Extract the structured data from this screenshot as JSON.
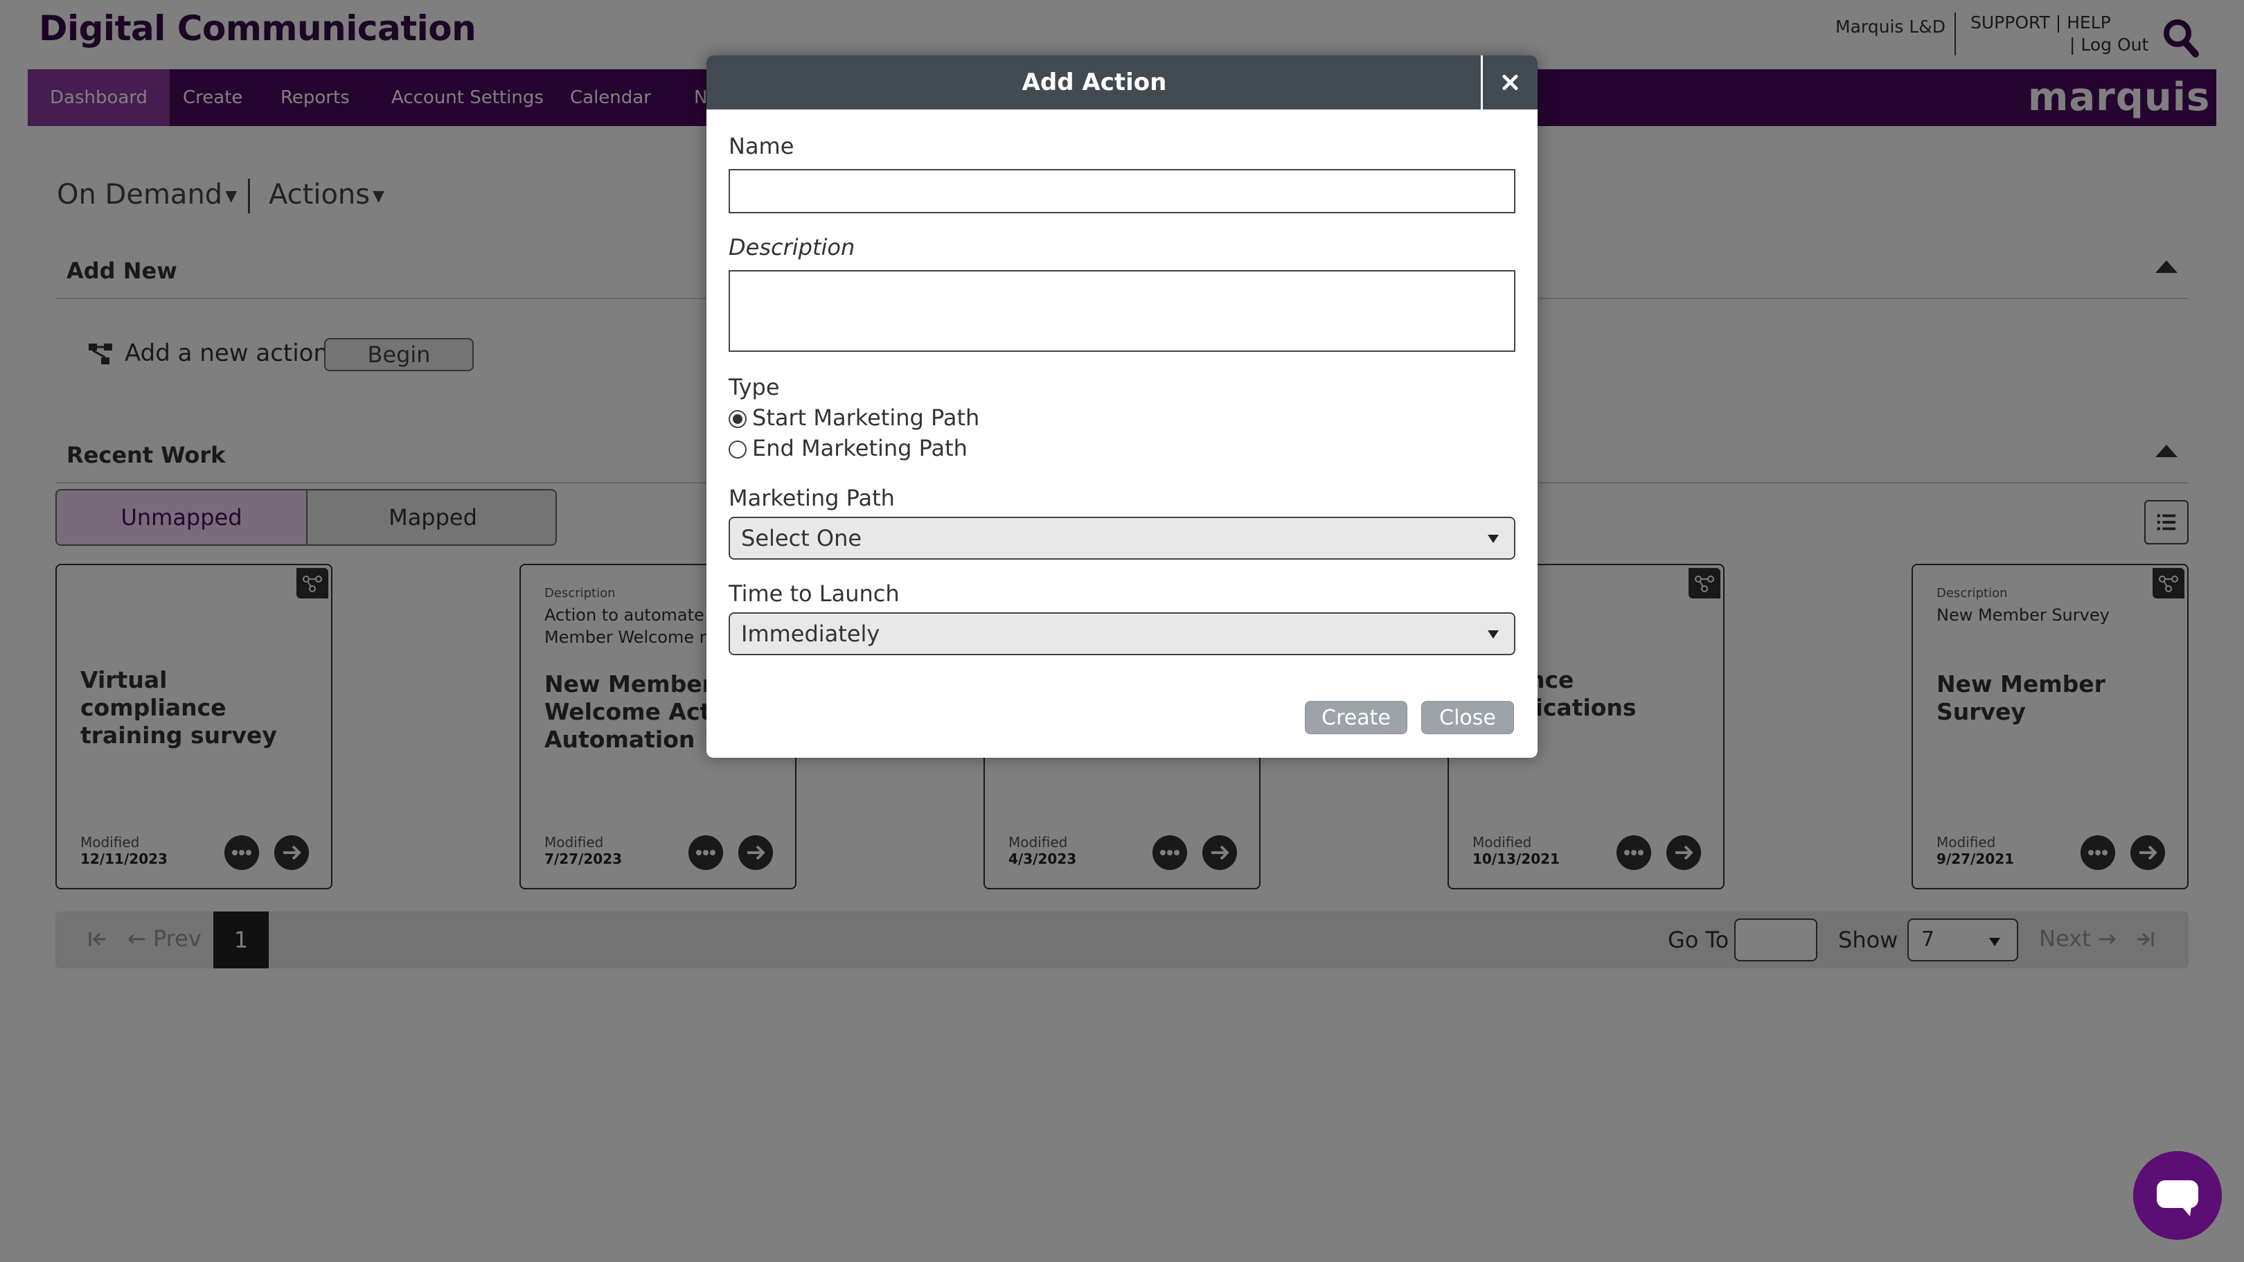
{
  "header": {
    "app_title": "Digital Communication",
    "user_name": "Marquis L&D",
    "support_links": "SUPPORT | HELP",
    "logout": "| Log Out",
    "brand": "marquis"
  },
  "nav": {
    "items": [
      {
        "label": "Dashboard",
        "active": true
      },
      {
        "label": "Create"
      },
      {
        "label": "Reports"
      },
      {
        "label": "Account Settings"
      },
      {
        "label": "Calendar"
      },
      {
        "label": "N"
      }
    ]
  },
  "breadcrumb": {
    "primary": "On Demand",
    "secondary": "Actions"
  },
  "add_new": {
    "section_title": "Add New",
    "label": "Add a new action",
    "button": "Begin"
  },
  "recent_work": {
    "section_title": "Recent Work",
    "toggle": [
      "Unmapped",
      "Mapped"
    ],
    "cards": [
      {
        "description_label": "",
        "description": "",
        "title": "Virtual compliance training survey",
        "modified_label": "Modified",
        "modified_date": "12/11/2023"
      },
      {
        "description_label": "Description",
        "description": "Action to automate a Member Welcome m",
        "title": "New Member Welcome Action Automation",
        "modified_label": "Modified",
        "modified_date": "7/27/2023"
      },
      {
        "description_label": "",
        "description": "",
        "title": "",
        "modified_label": "Modified",
        "modified_date": "4/3/2023"
      },
      {
        "description_label": "",
        "description": "",
        "title": "Balance Notifications",
        "modified_label": "Modified",
        "modified_date": "10/13/2021"
      },
      {
        "description_label": "Description",
        "description": "New Member Survey",
        "title": "New Member Survey",
        "modified_label": "Modified",
        "modified_date": "9/27/2021"
      }
    ]
  },
  "pager": {
    "prev": "Prev",
    "current_page": "1",
    "goto_label": "Go To",
    "show_label": "Show",
    "show_value": "7",
    "next": "Next"
  },
  "modal": {
    "title": "Add Action",
    "name_label": "Name",
    "name_value": "",
    "description_label": "Description",
    "description_value": "",
    "type_label": "Type",
    "type_options": [
      {
        "label": "Start Marketing Path",
        "checked": true
      },
      {
        "label": "End Marketing Path",
        "checked": false
      }
    ],
    "marketing_path_label": "Marketing Path",
    "marketing_path_value": "Select One",
    "time_to_launch_label": "Time to Launch",
    "time_to_launch_value": "Immediately",
    "create_button": "Create",
    "close_button": "Close"
  },
  "colors": {
    "brand_purple": "#4a0a5e",
    "nav_active": "#8a3aa0",
    "modal_header": "#424a52",
    "chat_bubble": "#5b0e74"
  }
}
